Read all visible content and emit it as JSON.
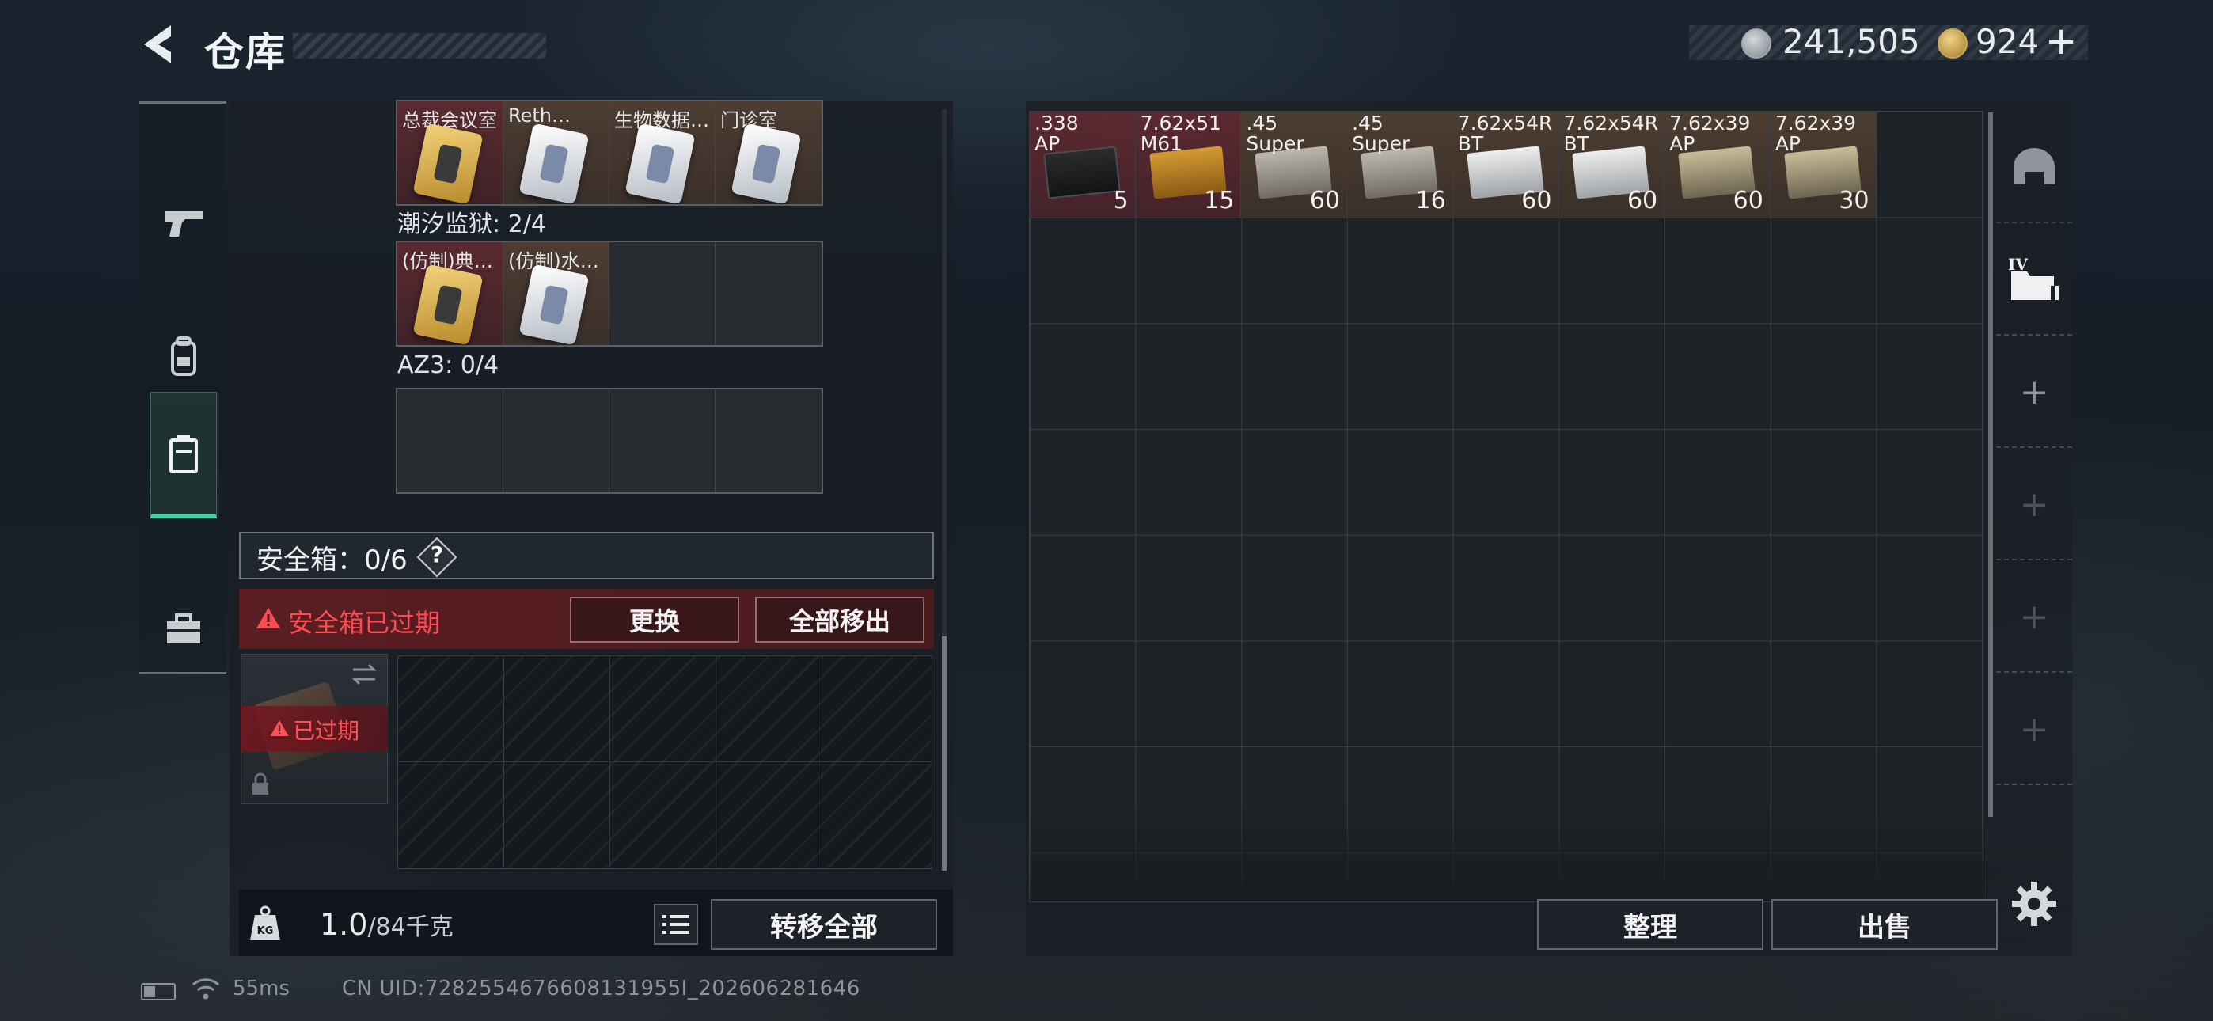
{
  "header": {
    "title": "仓库",
    "currency_silver": "241,505",
    "currency_gold": "924",
    "add_label": "+"
  },
  "side_nav": {
    "items": [
      {
        "name": "weapon",
        "icon": "pistol-icon"
      },
      {
        "name": "gear",
        "icon": "backpack-icon"
      },
      {
        "name": "container",
        "icon": "case-icon",
        "active": true
      },
      {
        "name": "medkit",
        "icon": "toolbox-icon"
      }
    ]
  },
  "left_panel": {
    "top_row": {
      "cells": [
        {
          "label": "总裁会议室",
          "style": "red",
          "card": "gold"
        },
        {
          "label": "Reth…",
          "style": "brown",
          "card": "white"
        },
        {
          "label": "生物数据…",
          "style": "brown",
          "card": "white"
        },
        {
          "label": "门诊室",
          "style": "brown",
          "card": "white"
        }
      ]
    },
    "section_prison": {
      "label": "潮汐监狱: 2/4",
      "cells": [
        {
          "label": "(仿制)典…",
          "style": "red",
          "card": "gold"
        },
        {
          "label": "(仿制)水…",
          "style": "brown",
          "card": "white"
        },
        {
          "label": "",
          "style": "empty"
        },
        {
          "label": "",
          "style": "empty"
        }
      ]
    },
    "section_az3": {
      "label": "AZ3: 0/4"
    },
    "safe_box": {
      "label": "安全箱：0/6",
      "help": "?",
      "warning": "安全箱已过期",
      "swap_button": "更换",
      "move_all_button": "全部移出",
      "expired_label": "已过期"
    },
    "weight": {
      "current": "1.0",
      "max": "/84千克"
    },
    "transfer_all_button": "转移全部"
  },
  "stash": {
    "items": [
      {
        "name": ".338\nAP",
        "count": "5",
        "style": "red",
        "box": "black"
      },
      {
        "name": "7.62x51\nM61",
        "count": "15",
        "style": "red",
        "box": "yellow"
      },
      {
        "name": ".45\nSuper",
        "count": "60",
        "style": "brown",
        "box": "gray"
      },
      {
        "name": ".45\nSuper",
        "count": "16",
        "style": "brown",
        "box": "gray"
      },
      {
        "name": "7.62x54R\nBT",
        "count": "60",
        "style": "brown",
        "box": "white"
      },
      {
        "name": "7.62x54R\nBT",
        "count": "60",
        "style": "brown",
        "box": "white"
      },
      {
        "name": "7.62x39\nAP",
        "count": "60",
        "style": "brown",
        "box": "khaki"
      },
      {
        "name": "7.62x39\nAP",
        "count": "30",
        "style": "brown",
        "box": "khaki"
      }
    ],
    "sort_button": "整理",
    "sell_button": "出售",
    "tabs": [
      {
        "icon": "helmet-icon"
      },
      {
        "icon": "folder-iv-icon",
        "badge": "IV"
      },
      {
        "icon": "plus-icon",
        "label": "+"
      },
      {
        "icon": "plus-icon",
        "label": "+"
      },
      {
        "icon": "plus-icon",
        "label": "+"
      },
      {
        "icon": "plus-icon",
        "label": "+"
      }
    ]
  },
  "footer": {
    "ping": "55ms",
    "uid": "CN UID:7282554676608131955I_202606281646"
  },
  "colors": {
    "accent_green": "#3fd3a2",
    "warning_red": "#ff4a52"
  }
}
